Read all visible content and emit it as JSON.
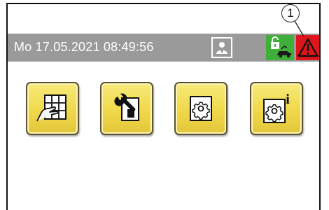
{
  "status_bar": {
    "datetime": "Mo 17.05.2021  08:49:56"
  },
  "callout": {
    "number": "1"
  },
  "icons": {
    "user": "user-icon",
    "unlocked_vehicle": "unlocked-vehicle-icon",
    "warning": "warning-triangle-icon"
  },
  "menu_tiles": [
    {
      "icon": "keypad-hand-icon"
    },
    {
      "icon": "service-wrench-icon"
    },
    {
      "icon": "settings-gear-icon"
    },
    {
      "icon": "settings-info-icon",
      "badge": "i"
    }
  ],
  "colors": {
    "status_bar": "#9a9a9a",
    "ok_green": "#3fae3a",
    "alarm_red": "#e0141b",
    "tile_yellow": "#f0d84a"
  }
}
